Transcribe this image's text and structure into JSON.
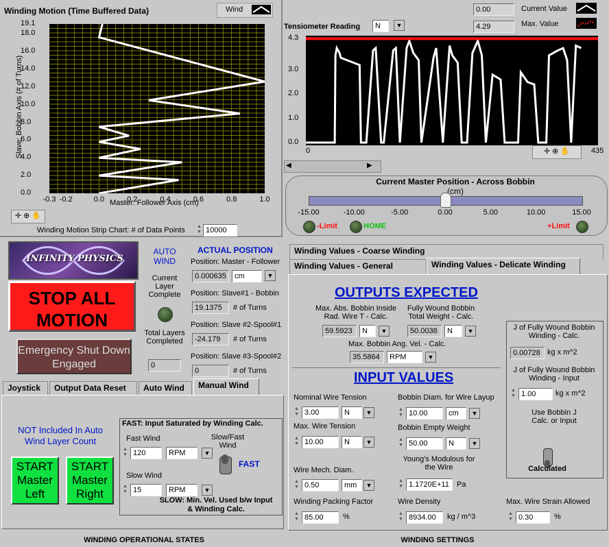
{
  "colors": {
    "plot_bg": "#000000",
    "grid": "#a0a000",
    "trace": "#ffffff",
    "max_line": "#ff1010",
    "stop_red": "#ff1a1a",
    "start_green": "#10e040",
    "accent_blue": "#0016c8"
  },
  "winding_chart": {
    "title": "Winding Motion (Time Buffered Data)",
    "legend_label": "Wind",
    "ylabel": "Slave: Bobbin Axis (# of Turns)",
    "xlabel": "Master: Follower Axis (cm)",
    "y_ticks": [
      "19.1",
      "18.0",
      "16.0",
      "14.0",
      "12.0",
      "10.0",
      "8.0",
      "6.0",
      "4.0",
      "2.0",
      "0.0"
    ],
    "x_ticks": [
      "-0.3",
      "-0.2",
      "0.0",
      "0.2",
      "0.4",
      "0.6",
      "0.8",
      "1.0"
    ],
    "strip_label": "Winding Motion Strip Chart: # of Data Points",
    "strip_points": "10000",
    "chart_data": {
      "type": "line",
      "xlim": [
        -0.3,
        1.0
      ],
      "ylim": [
        0,
        19.1
      ],
      "x": [
        0.0,
        0.48,
        0.0,
        0.5,
        0.0,
        0.25,
        0.0,
        0.18,
        0.0,
        0.85,
        0.3,
        1.0,
        0.0,
        0.02
      ],
      "y": [
        0.0,
        1.5,
        2.0,
        3.5,
        4.0,
        5.0,
        5.8,
        6.5,
        7.5,
        9.0,
        10.5,
        12.6,
        17.6,
        19.1
      ]
    }
  },
  "tension_chart": {
    "label": "Tensiometer Reading",
    "unit": "N",
    "current_value": "0.00",
    "current_value_label": "Current Value",
    "max_value": "4.29",
    "max_value_label": "Max. Value",
    "y_ticks": [
      "4.3",
      "3.0",
      "2.0",
      "1.0",
      "0.0"
    ],
    "x_ticks": [
      "0",
      "435"
    ],
    "chart_data": {
      "type": "line",
      "xlim": [
        0,
        435
      ],
      "ylim": [
        0,
        4.3
      ],
      "series": [
        {
          "x": [
            0,
            43,
            44,
            46,
            50,
            52,
            80,
            82,
            90,
            100,
            104,
            112,
            116,
            130,
            134,
            140,
            150,
            154,
            160,
            168,
            172,
            190,
            194,
            204,
            214,
            218,
            226,
            232,
            240,
            248,
            256,
            262,
            268,
            278,
            290,
            296,
            316,
            320,
            330,
            340,
            346,
            358,
            362,
            375,
            383,
            389,
            395,
            402,
            410
          ],
          "y": [
            0,
            0,
            3.6,
            3.9,
            3.7,
            3.5,
            3.2,
            0,
            0,
            3.8,
            3.9,
            0,
            0,
            3.8,
            3.9,
            0,
            3.9,
            4.2,
            3.7,
            3.4,
            0,
            3.5,
            3.9,
            0,
            4.0,
            3.6,
            3.3,
            0,
            0,
            3.7,
            4.2,
            3.6,
            0,
            2.8,
            2.6,
            0,
            0,
            2.9,
            2.5,
            2.4,
            0,
            0,
            3.6,
            3.8,
            3.9,
            3.4,
            0,
            4.0,
            3.9
          ]
        },
        {
          "x": [
            0,
            435
          ],
          "y": [
            4.29,
            4.29
          ]
        }
      ]
    }
  },
  "master_position": {
    "title": "Current Master Position - Across Bobbin",
    "unit": "(cm)",
    "ticks": [
      "-15.00",
      "-10.00",
      "-5.00",
      "0.00",
      "5.00",
      "10.00",
      "15.00"
    ],
    "value": 0.0,
    "minus_limit": "-Limit",
    "home": "HOME",
    "plus_limit": "+Limit"
  },
  "left_panel": {
    "logo_text": "INFINITY PHYSICS",
    "stop_label": "STOP ALL MOTION",
    "emergency_label": "Emergency Shut Down Engaged",
    "auto_wind": "AUTO WIND",
    "current_layer_complete": "Current Layer Complete",
    "total_layers": "Total Layers Completed",
    "total_layers_value": "0",
    "actual_position": "ACTUAL POSITION",
    "pos_master_label": "Position: Master - Follower",
    "pos_master_value": "0.000635",
    "pos_master_unit": "cm",
    "slave1_label": "Position: Slave#1 - Bobbin",
    "slave1_value": "19.1375",
    "slave2_label": "Position: Slave #2-Spool#1",
    "slave2_value": "-24.179",
    "slave3_label": "Position: Slave #3-Spool#2",
    "slave3_value": "0",
    "turns": "# of Turns",
    "tabs": [
      "Joystick",
      "Output Data Reset",
      "Auto Wind",
      "Manual Wind"
    ],
    "not_included": "NOT Included In Auto Wind Layer Count",
    "start_left": "START Master Left",
    "start_right": "START Master Right",
    "fast_title": "FAST: Input Saturated by Winding Calc.",
    "fast_wind": "Fast Wind",
    "fast_value": "120",
    "slow_wind": "Slow Wind",
    "slow_value": "15",
    "rpm": "RPM",
    "slowfast_label": "Slow/Fast Wind",
    "fast_state": "FAST",
    "slow_note": "SLOW: Min. Vel. Used b/w Input & Winding Calc.",
    "footer": "WINDING OPERATIONAL STATES"
  },
  "right_panel": {
    "tab_coarse": "Winding Values - Coarse Winding",
    "tab_general": "Winding Values - General",
    "tab_delicate": "Winding Values - Delicate Winding",
    "outputs_title": "OUTPUTS EXPECTED",
    "max_abs_label": "Max. Abs. Bobbin Inside Rad. Wire T - Calc.",
    "max_abs_value": "59.5923",
    "max_abs_unit": "N",
    "full_weight_label": "Fully Wound Bobbin Total Weight - Calc.",
    "full_weight_value": "50.0038",
    "full_weight_unit": "N",
    "ang_vel_label": "Max. Bobbin Ang. Vel. - Calc.",
    "ang_vel_value": "35.5864",
    "ang_vel_unit": "RPM",
    "inputs_title": "INPUT VALUES",
    "nom_tension_label": "Nominal Wire Tension",
    "nom_tension_value": "3.00",
    "nom_tension_unit": "N",
    "max_tension_label": "Max. Wire Tension",
    "max_tension_value": "10.00",
    "max_tension_unit": "N",
    "mech_diam_label": "Wire Mech. Diam.",
    "mech_diam_value": "0.50",
    "mech_diam_unit": "mm",
    "packing_label": "Winding Packing Factor",
    "packing_value": "85.00",
    "packing_unit": "%",
    "bobbin_diam_label": "Bobbin Diam. for Wire Layup",
    "bobbin_diam_value": "10.00",
    "bobbin_diam_unit": "cm",
    "empty_weight_label": "Bobbin Empty Weight",
    "empty_weight_value": "50.00",
    "empty_weight_unit": "N",
    "youngs_label": "Young's Modulous for the Wire",
    "youngs_value": "1.1720E+11",
    "youngs_unit": "Pa",
    "density_label": "Wire Density",
    "density_value": "8934.00",
    "density_unit": "kg / m^3",
    "strain_label": "Max. Wire Strain Allowed",
    "strain_value": "0.30",
    "strain_unit": "%",
    "j_calc_label": "J of Fully Wound Bobbin Winding - Calc.",
    "j_calc_value": "0.00728",
    "j_unit": "kg x m^2",
    "j_input_label": "J of Fully Wound Bobbin Winding - Input",
    "j_input_value": "1.00",
    "use_j_label": "Use Bobbin J Calc. or Input",
    "use_j_state": "Calculated",
    "footer": "WINDING SETTINGS"
  }
}
